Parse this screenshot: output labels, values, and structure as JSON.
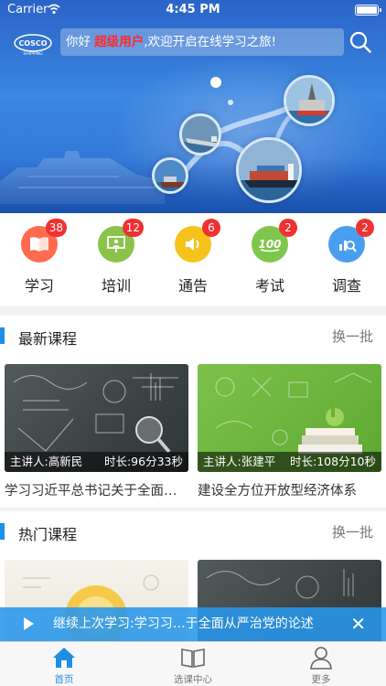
{
  "status_bar": {
    "carrier": "Carrier",
    "time": "4:45 PM"
  },
  "header": {
    "greeting_prefix": "你好 ",
    "user_name": "超级用户",
    "greeting_suffix": ",欢迎开启在线学习之旅!",
    "logo_text": "COSCO",
    "logo_subtext": "SHIPPING"
  },
  "categories": [
    {
      "label": "学习",
      "badge": "38",
      "color": "#ff6b4f",
      "icon": "book-icon"
    },
    {
      "label": "培训",
      "badge": "12",
      "color": "#8bc34a",
      "icon": "presentation-icon"
    },
    {
      "label": "通告",
      "badge": "6",
      "color": "#f6c31d",
      "icon": "speaker-icon"
    },
    {
      "label": "考试",
      "badge": "2",
      "color": "#7ec74c",
      "icon": "score-icon"
    },
    {
      "label": "调查",
      "badge": "2",
      "color": "#4a9ef0",
      "icon": "analytics-icon"
    }
  ],
  "latest": {
    "title": "最新课程",
    "more": "换一批",
    "courses": [
      {
        "lecturer": "主讲人:高新民",
        "duration": "时长:96分33秒",
        "title": "学习习近平总书记关于全面从严治党的论述"
      },
      {
        "lecturer": "主讲人:张建平",
        "duration": "时长:108分10秒",
        "title": "建设全方位开放型经济体系"
      }
    ]
  },
  "popular": {
    "title": "热门课程",
    "more": "换一批"
  },
  "continue_bar": {
    "text": "继续上次学习:学习习…于全面从严治党的论述"
  },
  "tabbar": [
    {
      "label": "首页",
      "active": true
    },
    {
      "label": "选课中心",
      "active": false
    },
    {
      "label": "更多",
      "active": false
    }
  ]
}
